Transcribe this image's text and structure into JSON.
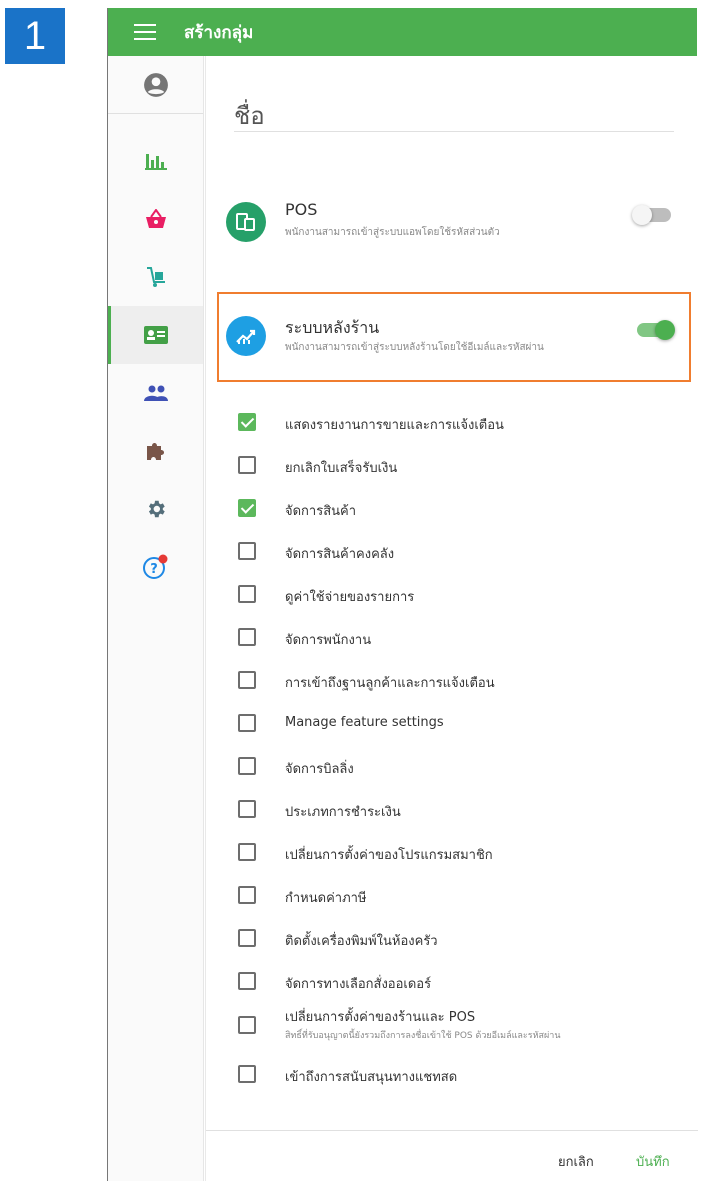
{
  "step_number": "1",
  "topbar": {
    "title": "สร้างกลุ่ม"
  },
  "sidebar": {
    "items": [
      {
        "icon": "account-circle-icon",
        "color": "#757575"
      },
      {
        "icon": "bar-chart-icon",
        "color": "#4caf50"
      },
      {
        "icon": "shopping-basket-icon",
        "color": "#e91e63"
      },
      {
        "icon": "dolly-icon",
        "color": "#26a69a"
      },
      {
        "icon": "id-card-icon",
        "color": "#43a047",
        "active": true
      },
      {
        "icon": "people-icon",
        "color": "#3f51b5"
      },
      {
        "icon": "puzzle-icon",
        "color": "#795548"
      },
      {
        "icon": "gear-icon",
        "color": "#546e7a"
      },
      {
        "icon": "help-icon",
        "color": "#1e88e5",
        "badge_color": "#e53935"
      }
    ]
  },
  "form": {
    "name_label": "ชื่อ"
  },
  "pos": {
    "title": "POS",
    "subtitle": "พนักงานสามารถเข้าสู่ระบบแอพโดยใช้รหัสส่วนตัว",
    "enabled": false,
    "icon": "devices-icon",
    "icon_color": "#26a069"
  },
  "backoffice": {
    "title": "ระบบหลังร้าน",
    "subtitle": "พนักงานสามารถเข้าสู่ระบบหลังร้านโดยใช้อีเมล์และรหัสผ่าน",
    "enabled": true,
    "icon": "trending-chart-icon",
    "icon_color": "#1e9fe3"
  },
  "permissions": [
    {
      "label": "แสดงรายงานการขายและการแจ้งเตือน",
      "checked": true
    },
    {
      "label": "ยกเลิกใบเสร็จรับเงิน",
      "checked": false
    },
    {
      "label": "จัดการสินค้า",
      "checked": true
    },
    {
      "label": "จัดการสินค้าคงคลัง",
      "checked": false
    },
    {
      "label": "ดูค่าใช้จ่ายของรายการ",
      "checked": false
    },
    {
      "label": "จัดการพนักงาน",
      "checked": false
    },
    {
      "label": "การเข้าถึงฐานลูกค้าและการแจ้งเตือน",
      "checked": false
    },
    {
      "label": "Manage feature settings",
      "checked": false
    },
    {
      "label": "จัดการบิลลิ่ง",
      "checked": false
    },
    {
      "label": "ประเภทการชำระเงิน",
      "checked": false
    },
    {
      "label": "เปลี่ยนการตั้งค่าของโปรแกรมสมาชิก",
      "checked": false
    },
    {
      "label": "กำหนดค่าภาษี",
      "checked": false
    },
    {
      "label": "ติดตั้งเครื่องพิมพ์ในห้องครัว",
      "checked": false
    },
    {
      "label": "จัดการทางเลือกสั่งออเดอร์",
      "checked": false
    },
    {
      "label": "เปลี่ยนการตั้งค่าของร้านและ POS",
      "checked": false,
      "sub": "สิทธิ์ที่รับอนุญาตนี้ยังรวมถึงการลงชื่อเข้าใช้ POS ด้วยอีเมล์และรหัสผ่าน"
    },
    {
      "label": "เข้าถึงการสนับสนุนทางแชทสด",
      "checked": false
    }
  ],
  "footer": {
    "cancel_label": "ยกเลิก",
    "save_label": "บันทึก"
  },
  "colors": {
    "accent": "#4caf50",
    "highlight": "#f07d2f",
    "step_badge": "#1a73c8"
  }
}
